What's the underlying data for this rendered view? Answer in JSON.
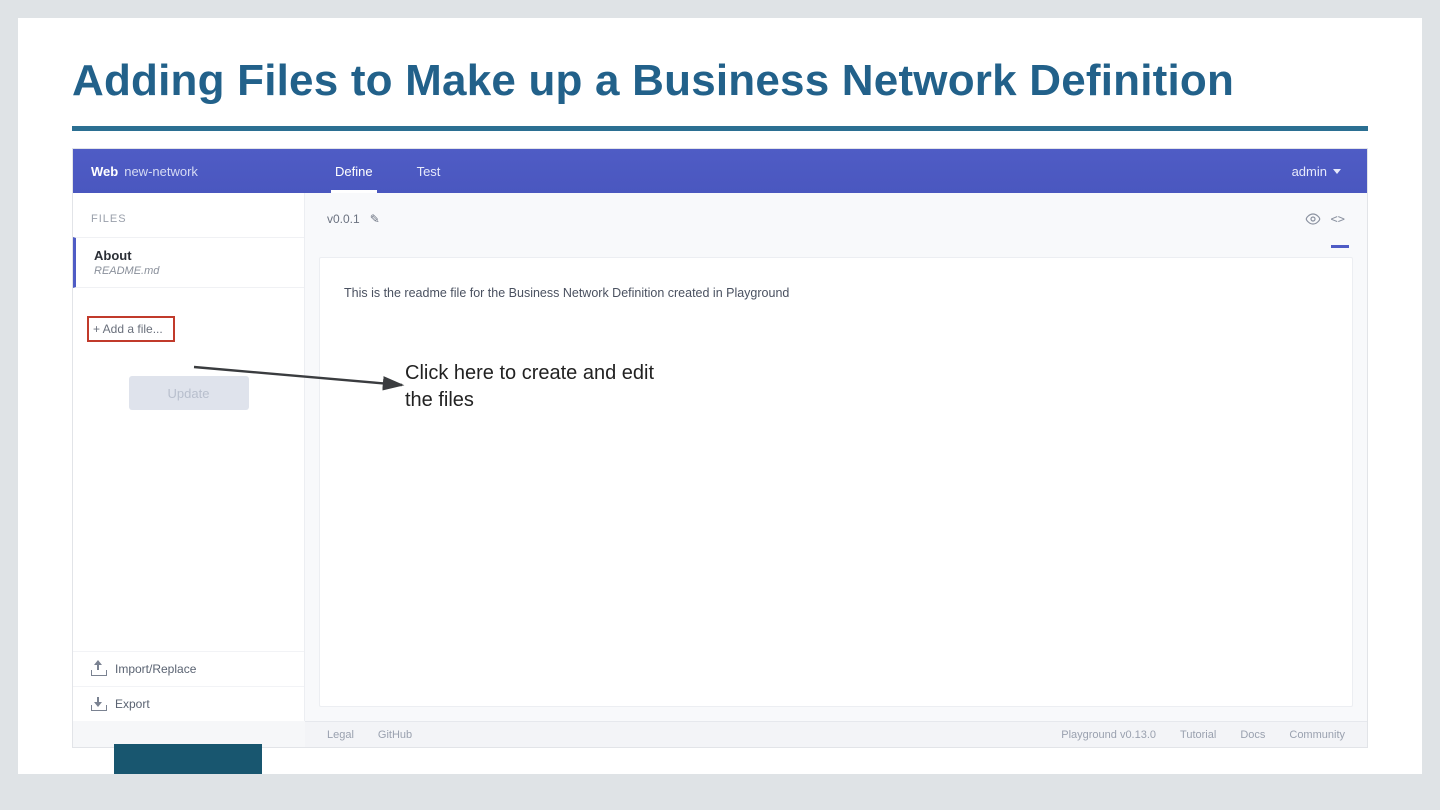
{
  "slide": {
    "title": "Adding Files to Make up a Business Network Definition",
    "annotation": "Click here to create and edit the files"
  },
  "topbar": {
    "brand_web": "Web",
    "brand_network": "new-network",
    "tabs": {
      "define": "Define",
      "test": "Test"
    },
    "user": "admin"
  },
  "sidebar": {
    "files_label": "FILES",
    "about": {
      "primary": "About",
      "secondary": "README.md"
    },
    "add_file": "+ Add a file...",
    "update": "Update",
    "import_replace": "Import/Replace",
    "export": "Export"
  },
  "main": {
    "version": "v0.0.1",
    "readme_body": "This is the readme file for the Business Network Definition created in Playground"
  },
  "footer": {
    "legal": "Legal",
    "github": "GitHub",
    "playground_version": "Playground v0.13.0",
    "tutorial": "Tutorial",
    "docs": "Docs",
    "community": "Community"
  }
}
